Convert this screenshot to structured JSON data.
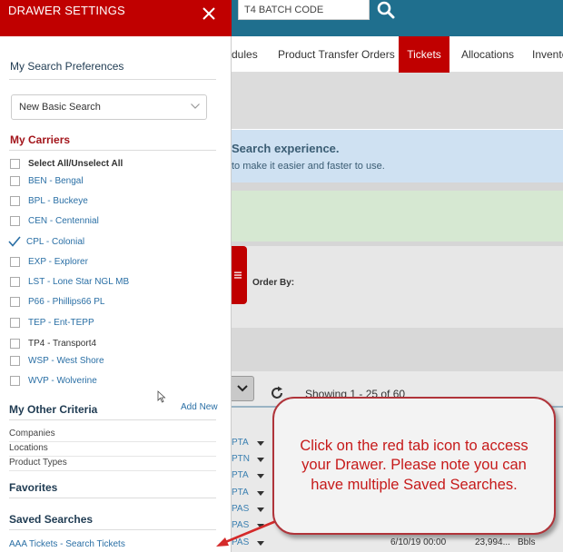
{
  "header": {
    "batch_placeholder": "T4 BATCH CODE"
  },
  "nav": {
    "tabs": [
      {
        "label": "dules"
      },
      {
        "label": "Product Transfer Orders"
      },
      {
        "label": "Tickets"
      },
      {
        "label": "Allocations"
      },
      {
        "label": "Invento"
      }
    ],
    "active": "Tickets"
  },
  "banner": {
    "title": "Search experience.",
    "subtitle": "to make it easier and faster to use."
  },
  "search_panel": {
    "order_by": "Order By:"
  },
  "results": {
    "showing": "Showing 1 - 25 of 60",
    "rows": [
      {
        "code": "PTA",
        "date": "",
        "volume": "",
        "unit": ""
      },
      {
        "code": "PTN",
        "date": "",
        "volume": "",
        "unit": ""
      },
      {
        "code": "PTA",
        "date": "",
        "volume": "",
        "unit": ""
      },
      {
        "code": "PTA",
        "date": "",
        "volume": "",
        "unit": ""
      },
      {
        "code": "PAS",
        "date": "",
        "volume": "",
        "unit": ""
      },
      {
        "code": "PAS",
        "date": "",
        "volume": "",
        "unit": ""
      },
      {
        "code": "PAS",
        "date": "",
        "volume": "",
        "unit": ""
      },
      {
        "code": "PAS",
        "date": "6/10/19 00:00",
        "volume": "23,994...",
        "unit": "Bbls"
      }
    ]
  },
  "drawer": {
    "title": "DRAWER SETTINGS",
    "search_preferences": {
      "title": "My Search Preferences",
      "selected": "New Basic Search"
    },
    "carriers": {
      "title": "My Carriers",
      "select_all": "Select All/Unselect All",
      "items": [
        {
          "label": "BEN - Bengal",
          "checked": false
        },
        {
          "label": "BPL - Buckeye",
          "checked": false
        },
        {
          "label": "CEN - Centennial",
          "checked": false
        },
        {
          "label": "CPL - Colonial",
          "checked": true
        },
        {
          "label": "EXP - Explorer",
          "checked": false
        },
        {
          "label": "LST - Lone Star NGL MB",
          "checked": false
        },
        {
          "label": "P66 - Phillips66 PL",
          "checked": false
        },
        {
          "label": "TEP - Ent-TEPP",
          "checked": false
        },
        {
          "label": "TP4 - Transport4",
          "checked": false
        },
        {
          "label": "WSP - West Shore",
          "checked": false
        },
        {
          "label": "WVP - Wolverine",
          "checked": false
        }
      ]
    },
    "other_criteria": {
      "title": "My Other Criteria",
      "add_new": "Add New",
      "items": [
        "Companies",
        "Locations",
        "Product Types"
      ]
    },
    "favorites": {
      "title": "Favorites"
    },
    "saved_searches": {
      "title": "Saved Searches",
      "items": [
        "AAA Tickets - Search Tickets"
      ]
    }
  },
  "callout": {
    "text": "Click on the red tab icon to access your Drawer. Please note you can have multiple Saved Searches."
  },
  "colors": {
    "brand_red": "#c00000",
    "topbar_teal": "#1f6f8e",
    "link_blue": "#2a6fa5",
    "callout_red": "#c61a1a"
  }
}
